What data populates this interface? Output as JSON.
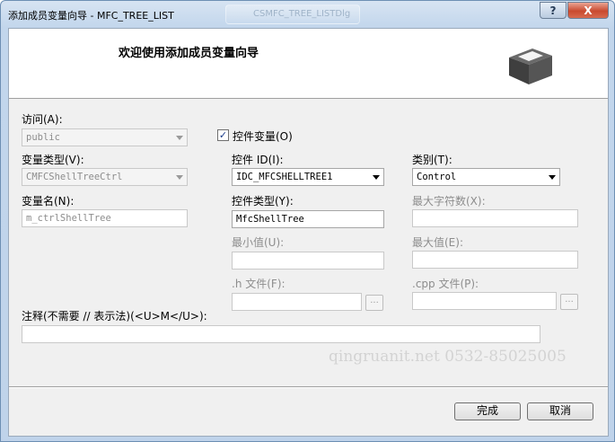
{
  "window": {
    "title": "添加成员变量向导 - MFC_TREE_LIST",
    "background_tab": "CSMFC_TREE_LISTDlg",
    "help_label": "?",
    "close_label": "X"
  },
  "banner": {
    "title": "欢迎使用添加成员变量向导",
    "icon": "box-3d-icon"
  },
  "form": {
    "access_label": "访问(A):",
    "access_value": "public",
    "control_var_label": "控件变量(O)",
    "control_var_checked": true,
    "var_type_label": "变量类型(V):",
    "var_type_value": "CMFCShellTreeCtrl",
    "control_id_label": "控件 ID(I):",
    "control_id_value": "IDC_MFCSHELLTREE1",
    "category_label": "类别(T):",
    "category_value": "Control",
    "var_name_label": "变量名(N):",
    "var_name_value": "m_ctrlShellTree",
    "control_type_label": "控件类型(Y):",
    "control_type_value": "MfcShellTree",
    "max_chars_label": "最大字符数(X):",
    "max_chars_value": "",
    "min_value_label": "最小值(U):",
    "min_value_value": "",
    "max_value_label": "最大值(E):",
    "max_value_value": "",
    "h_file_label": ".h 文件(F):",
    "h_file_value": "",
    "cpp_file_label": ".cpp 文件(P):",
    "cpp_file_value": "",
    "browse_label": "...",
    "comment_label": "注释(不需要 // 表示法)(<U>M</U>):",
    "comment_value": ""
  },
  "watermark": "qingruanit.net 0532-85025005",
  "buttons": {
    "finish": "完成",
    "cancel": "取消"
  }
}
